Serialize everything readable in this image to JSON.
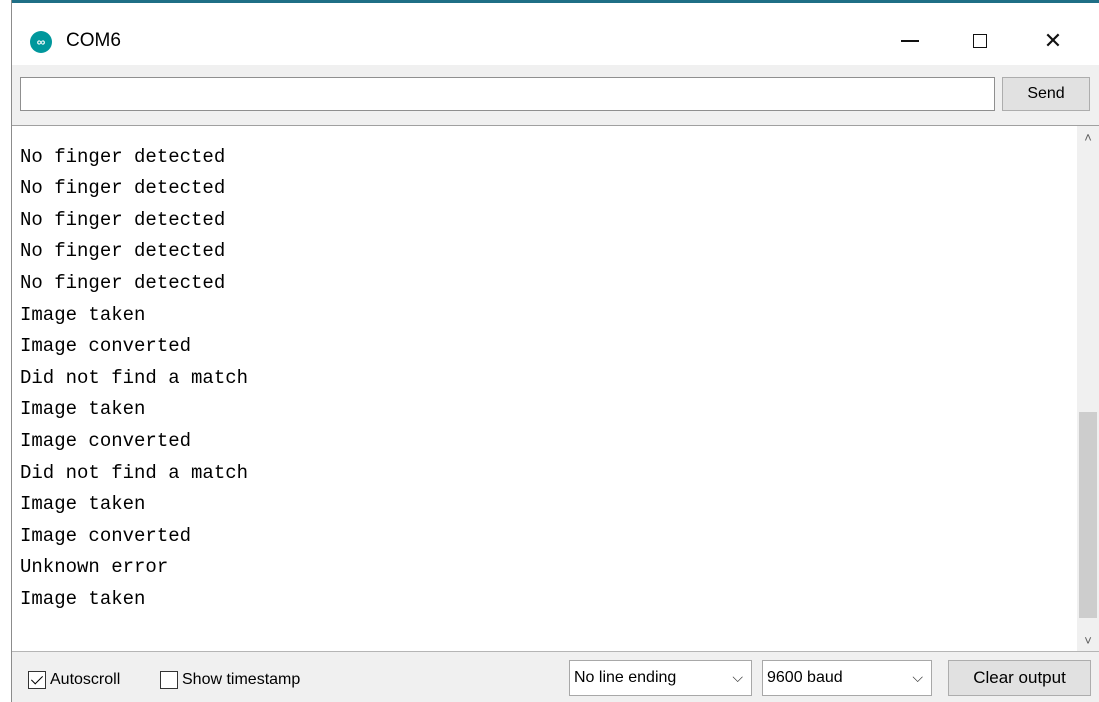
{
  "window": {
    "title": "COM6",
    "app_icon_glyph": "∞",
    "controls": {
      "minimize": "minimize-icon",
      "maximize": "maximize-icon",
      "close_glyph": "✕"
    }
  },
  "send": {
    "input_value": "",
    "input_placeholder": "",
    "button_label": "Send"
  },
  "output": {
    "lines": [
      "No finger detected",
      "No finger detected",
      "No finger detected",
      "No finger detected",
      "No finger detected",
      "Image taken",
      "Image converted",
      "Did not find a match",
      "Image taken",
      "Image converted",
      "Did not find a match",
      "Image taken",
      "Image converted",
      "Unknown error",
      "Image taken"
    ],
    "scroll_position_fraction": 0.75
  },
  "footer": {
    "autoscroll_label": "Autoscroll",
    "autoscroll_checked": true,
    "timestamp_label": "Show timestamp",
    "timestamp_checked": false,
    "line_ending_selected": "No line ending",
    "baud_selected": "9600 baud",
    "clear_label": "Clear output"
  },
  "colors": {
    "accent": "#00979c",
    "window_accent": "#1f6f86"
  }
}
